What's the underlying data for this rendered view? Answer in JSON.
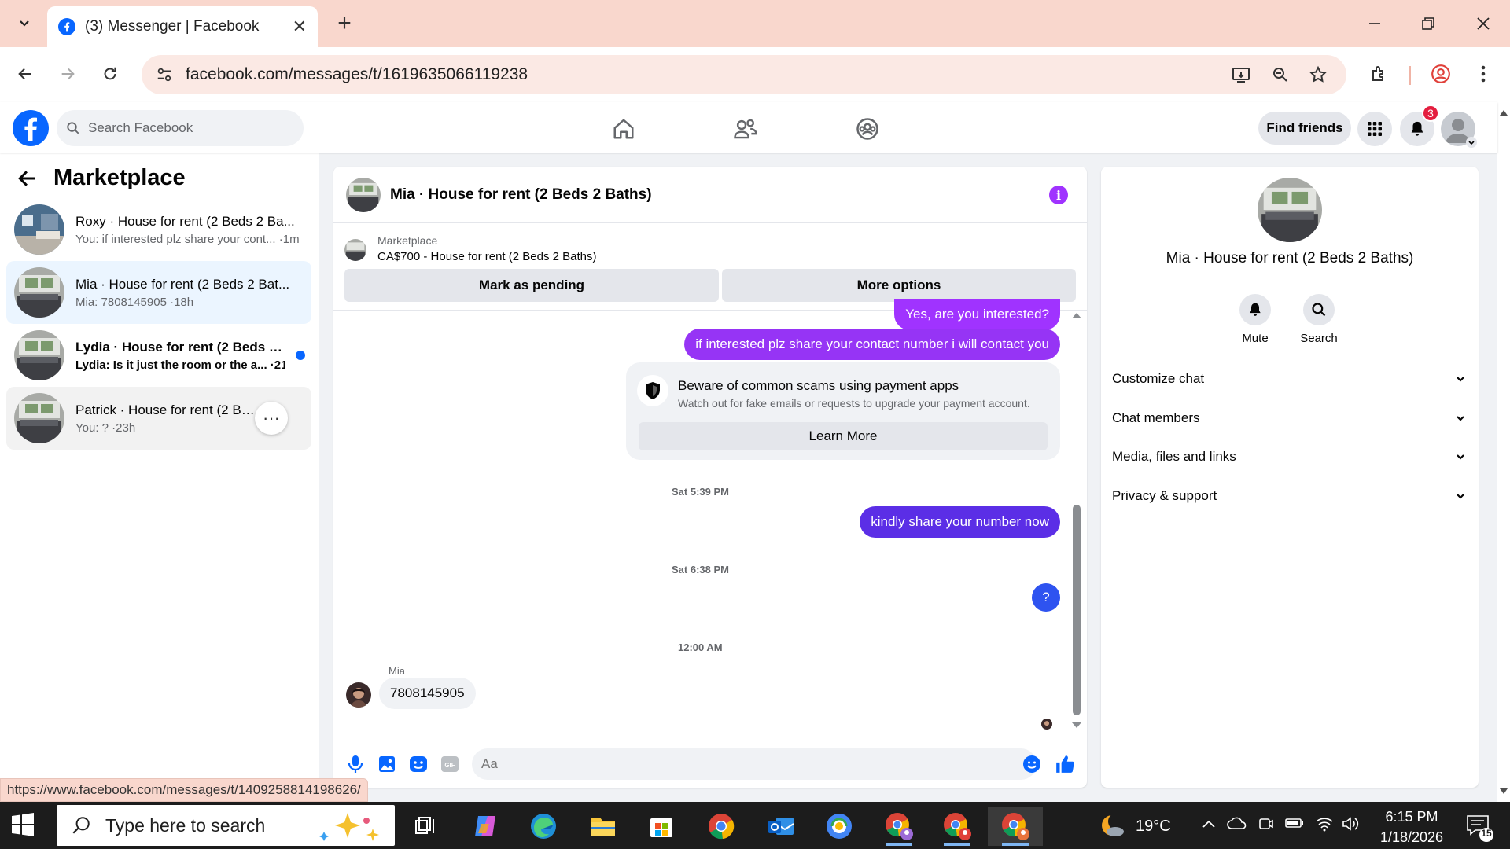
{
  "browser": {
    "tab_title": "(3) Messenger | Facebook",
    "url": "facebook.com/messages/t/1619635066119238",
    "status_url": "https://www.facebook.com/messages/t/1409258814198626/"
  },
  "fb_header": {
    "search_placeholder": "Search Facebook",
    "find_friends": "Find friends",
    "notifications_count": "3"
  },
  "sidebar": {
    "title": "Marketplace",
    "conversations": [
      {
        "name": "Roxy · House for rent (2 Beds 2 Ba...",
        "preview": "You: if interested plz share your cont... ·1m"
      },
      {
        "name": "Mia · House for rent (2 Beds 2 Bat...",
        "preview": "Mia: 7808145905 ·18h"
      },
      {
        "name": "Lydia · House for rent (2 Beds 2 ...",
        "preview": "Lydia: Is it just the room or the a... ·21h"
      },
      {
        "name": "Patrick · House for rent (2 Beds",
        "preview": "You: ? ·23h"
      }
    ]
  },
  "chat": {
    "title": "Mia · House for rent (2 Beds 2 Baths)",
    "listing_label": "Marketplace",
    "listing_title": "CA$700 - House for rent (2 Beds 2 Baths)",
    "mark_pending": "Mark as pending",
    "more_options": "More options",
    "messages": {
      "m1": "Yes, are you interested?",
      "m2": "if interested plz share your contact number i will contact you",
      "m3": "kindly share your number now",
      "m4": "?",
      "incoming": "7808145905"
    },
    "scam_title": "Beware of common scams using payment apps",
    "scam_text": "Watch out for fake emails or requests to upgrade your payment account.",
    "learn_more": "Learn More",
    "timestamps": [
      "Sat 5:39 PM",
      "Sat 6:38 PM",
      "12:00 AM"
    ],
    "sender": "Mia",
    "composer_placeholder": "Aa"
  },
  "info_panel": {
    "name": "Mia · House for rent (2 Beds 2 Baths)",
    "mute": "Mute",
    "search": "Search",
    "sections": [
      "Customize chat",
      "Chat members",
      "Media, files and links",
      "Privacy & support"
    ]
  },
  "taskbar": {
    "search_placeholder": "Type here to search",
    "temperature": "19°C",
    "time": "6:15 PM",
    "date": "1/18/2026",
    "notification_count": "15"
  },
  "colors": {
    "brand": "#0866ff",
    "bubble_purple": "#a033ff",
    "bubble_indigo": "#5b2ee6",
    "bubble_blue": "#2e53f0"
  }
}
